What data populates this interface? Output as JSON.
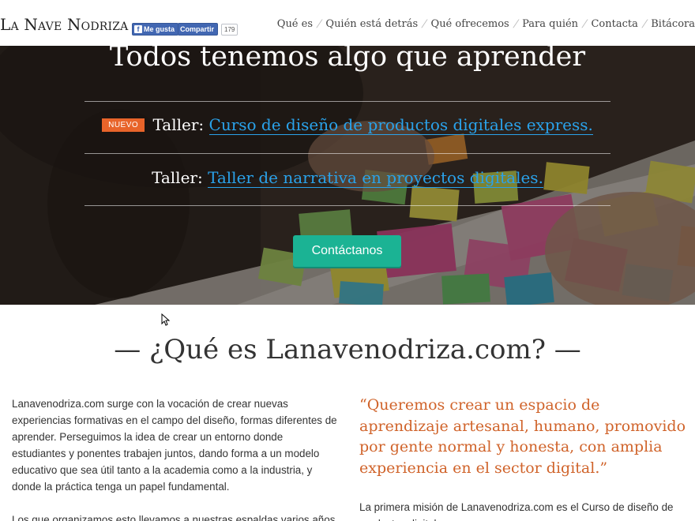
{
  "header": {
    "logo": "La Nave Nodriza",
    "fb_like_label": "Me gusta",
    "fb_share_label": "Compartir",
    "fb_count": "179",
    "nav": [
      {
        "label": "Qué es"
      },
      {
        "label": "Quién está detrás"
      },
      {
        "label": "Qué ofrecemos"
      },
      {
        "label": "Para quién"
      },
      {
        "label": "Contacta"
      },
      {
        "label": "Bitácora"
      }
    ]
  },
  "hero": {
    "title": "Todos tenemos algo que aprender",
    "workshops": [
      {
        "badge": "NUEVO",
        "prefix": "Taller:",
        "link": "Curso de diseño de productos digitales express."
      },
      {
        "badge": "",
        "prefix": "Taller:",
        "link": "Taller de narrativa en proyectos digitales."
      }
    ],
    "cta_label": "Contáctanos"
  },
  "section": {
    "title": "— ¿Qué es Lanavenodriza.com? —",
    "left_paragraphs": [
      "Lanavenodriza.com surge con la vocación de crear nuevas experiencias formativas en el campo del diseño, formas diferentes de aprender. Perseguimos la idea de crear un entorno donde estudiantes y ponentes trabajen juntos, dando forma a un modelo educativo que sea útil tanto a la academia como a la industria, y donde la práctica tenga un papel fundamental.",
      "Los que organizamos esto llevamos a nuestras espaldas varios años"
    ],
    "quote": "“Queremos crear un espacio de aprendizaje artesanal, humano, promovido por gente normal y honesta, con amplia experiencia en el sector digital.”",
    "right_paragraph": "La primera misión de Lanavenodriza.com es el Curso de diseño de productos digitales"
  },
  "colors": {
    "accent_orange": "#d0632a",
    "badge_orange": "#e8642a",
    "link_blue": "#2aa2ea",
    "cta_green": "#1bb394",
    "facebook_blue": "#4267b2"
  }
}
